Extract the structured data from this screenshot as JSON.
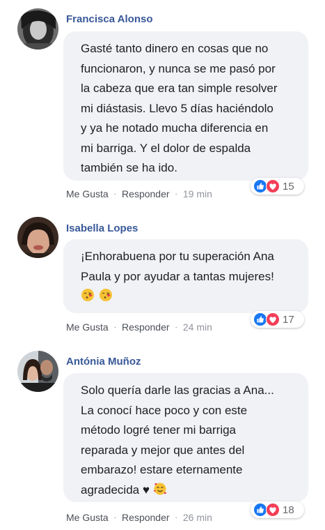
{
  "comments": [
    {
      "name": "Francisca Alonso",
      "lines": [
        "Gasté tanto dinero en cosas que no",
        "funcionaron, y nunca se me pasó por",
        "la cabeza que era tan simple resolver",
        "mi diástasis. Llevo 5 días haciéndolo",
        "y ya he notado mucha diferencia en",
        "mi barriga. Y el dolor de espalda",
        "también se ha ido."
      ],
      "like_label": "Me Gusta",
      "reply_label": "Responder",
      "time": "19 min",
      "reaction_count": "15",
      "reaction_icons": [
        "like-icon",
        "love-icon"
      ]
    },
    {
      "name": "Isabella Lopes",
      "lines": [
        "¡Enhorabuena por tu superación Ana",
        "Paula y por ayudar a tantas mujeres!"
      ],
      "emojis": [
        "kissing-heart-emoji",
        "kissing-heart-emoji"
      ],
      "like_label": "Me Gusta",
      "reply_label": "Responder",
      "time": "24 min",
      "reaction_count": "17",
      "reaction_icons": [
        "like-icon",
        "love-icon"
      ]
    },
    {
      "name": "Antónia Muñoz",
      "lines": [
        "Solo quería darle las gracias a Ana...",
        "La conocí hace poco y con este",
        "método logré tener mi barriga",
        "reparada y mejor que antes del",
        "embarazo! estare eternamente",
        "agradecida ♥"
      ],
      "emojis": [
        "smiling-hearts-emoji"
      ],
      "like_label": "Me Gusta",
      "reply_label": "Responder",
      "time": "26 min",
      "reaction_count": "18",
      "reaction_icons": [
        "like-icon",
        "love-icon"
      ]
    }
  ],
  "colors": {
    "name": "#385898",
    "bubble": "#f0f2f5",
    "like": "#1877f2",
    "love": "#f33e58"
  }
}
